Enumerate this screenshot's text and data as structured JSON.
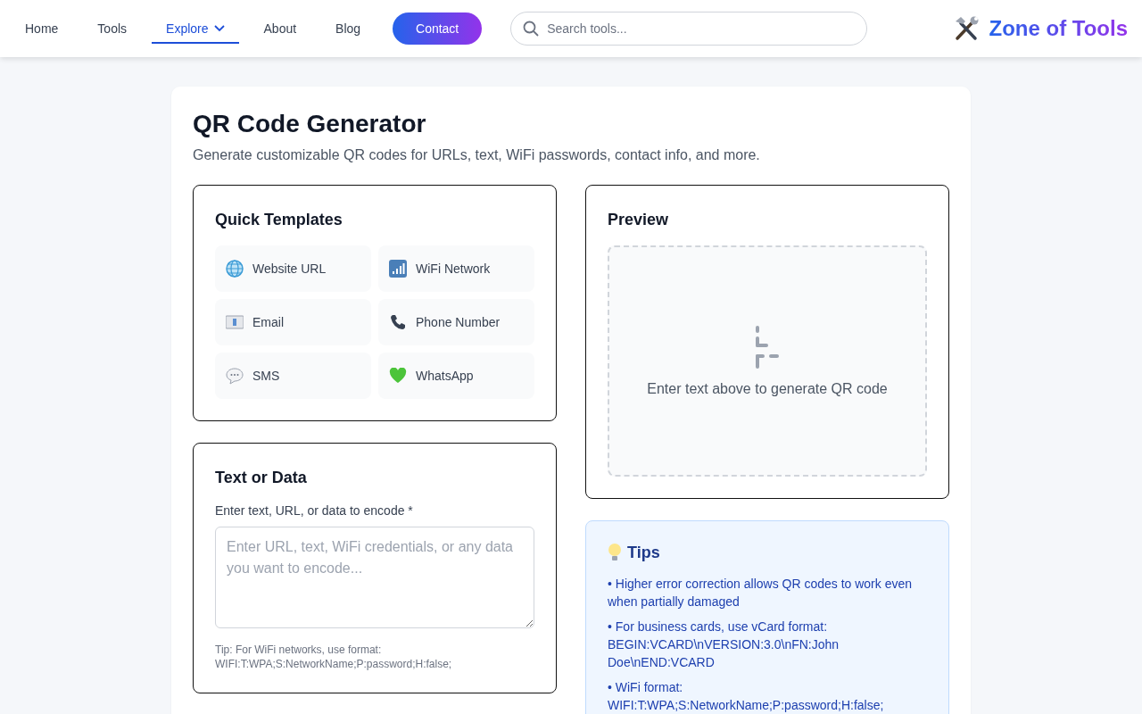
{
  "nav": {
    "items": [
      {
        "label": "Home",
        "selected": false,
        "dropdown": false
      },
      {
        "label": "Tools",
        "selected": false,
        "dropdown": false
      },
      {
        "label": "Explore",
        "selected": true,
        "dropdown": true
      },
      {
        "label": "About",
        "selected": false,
        "dropdown": false
      },
      {
        "label": "Blog",
        "selected": false,
        "dropdown": false
      }
    ],
    "contact": "Contact",
    "search": {
      "placeholder": "Search tools..."
    },
    "logo": "Zone of Tools"
  },
  "page": {
    "title": "QR Code Generator",
    "subtitle": "Generate customizable QR codes for URLs, text, WiFi passwords, contact info, and more."
  },
  "templates": {
    "title": "Quick Templates",
    "items": [
      {
        "label": "Website URL"
      },
      {
        "label": "WiFi Network"
      },
      {
        "label": "Email"
      },
      {
        "label": "Phone Number"
      },
      {
        "label": "SMS"
      },
      {
        "label": "WhatsApp"
      }
    ]
  },
  "input": {
    "title": "Text or Data",
    "label": "Enter text, URL, or data to encode *",
    "placeholder": "Enter URL, text, WiFi credentials, or any data you want to encode...",
    "hint": "Tip: For WiFi networks, use format: WIFI:T:WPA;S:NetworkName;P:password;H:false;"
  },
  "preview": {
    "title": "Preview",
    "empty": "Enter text above to generate QR code"
  },
  "tips": {
    "title": "Tips",
    "items": [
      "• Higher error correction allows QR codes to work even when partially damaged",
      "• For business cards, use vCard format: BEGIN:VCARD\\nVERSION:3.0\\nFN:John Doe\\nEND:VCARD",
      "• WiFi format: WIFI:T:WPA;S:NetworkName;P:password;H:false;"
    ]
  }
}
